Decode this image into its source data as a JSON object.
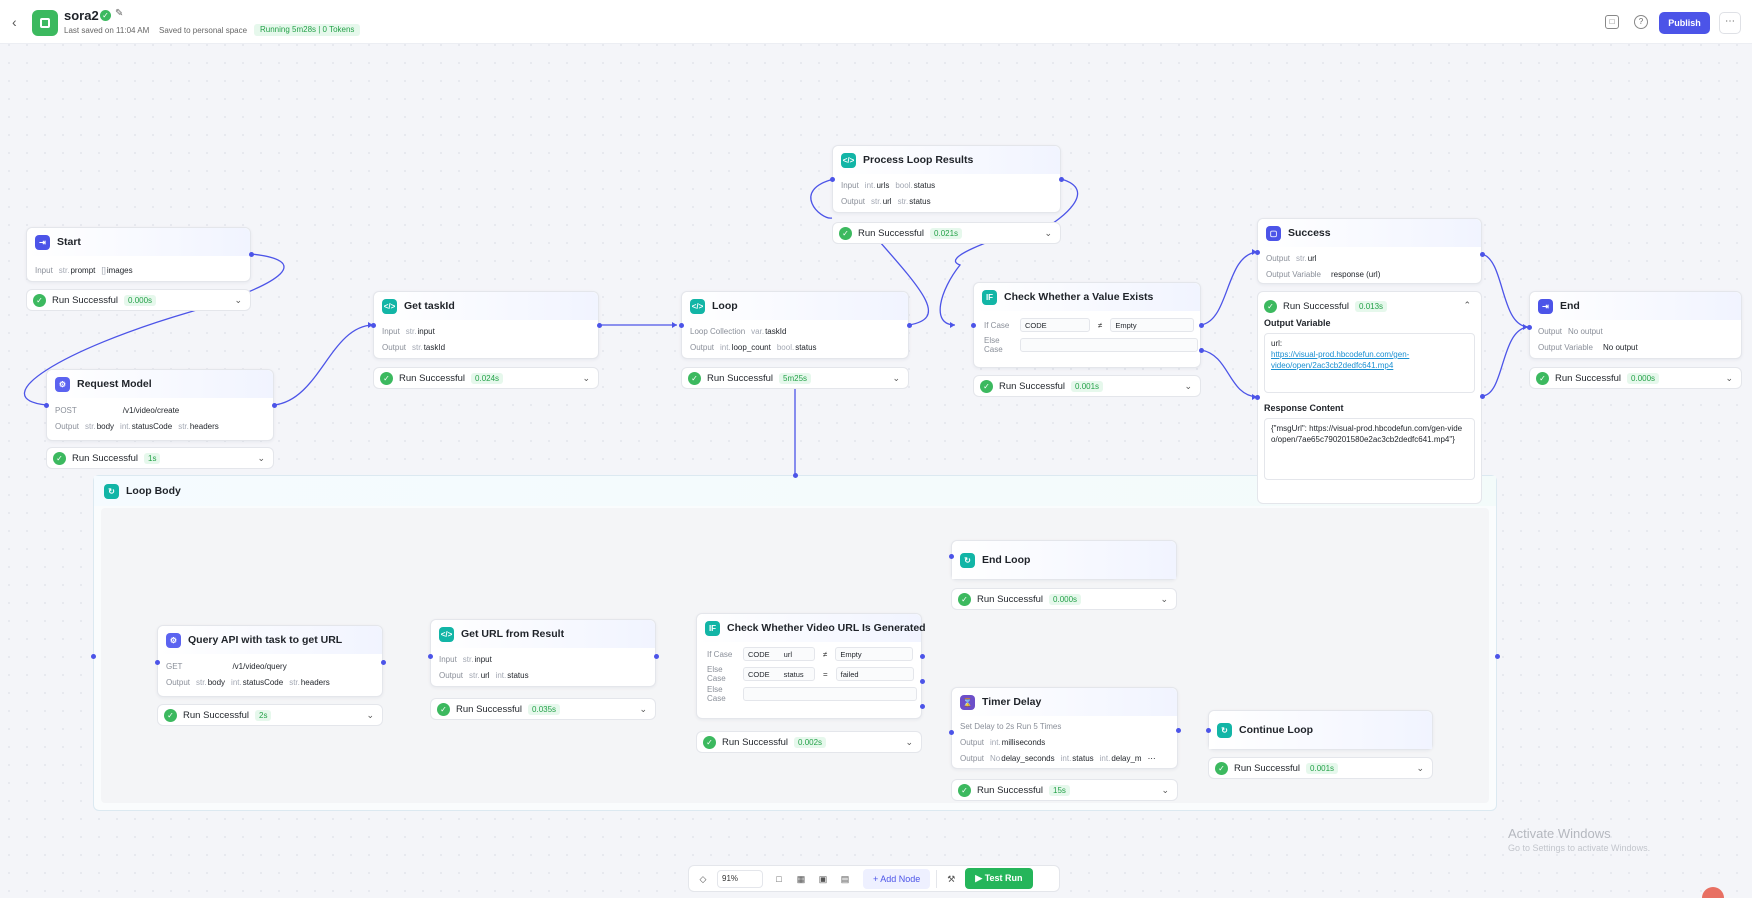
{
  "app": {
    "title": "sora2",
    "last_saved": "Last saved on 11:04 AM",
    "saved_space": "Saved to personal space",
    "running": "Running 5m28s | 0 Tokens",
    "publish": "Publish",
    "more": "⋯"
  },
  "colors": {
    "accent": "#4c54e8",
    "success": "#3cb95f",
    "success_text": "#24a148",
    "edge": "#4c54e8"
  },
  "nodes": {
    "start": {
      "title": "Start",
      "input_label": "Input",
      "in1_type": "str.",
      "in1_name": "prompt",
      "in2_type": "[]",
      "in2_name": "images",
      "status": "Run Successful",
      "time": "0.000s"
    },
    "request": {
      "title": "Request Model",
      "method": "POST",
      "url": "/v1/video/create",
      "output_label": "Output",
      "o1_type": "str.",
      "o1_name": "body",
      "o2_type": "int.",
      "o2_name": "statusCode",
      "o3_type": "str.",
      "o3_name": "headers",
      "status": "Run Successful",
      "time": "1s"
    },
    "gettask": {
      "title": "Get taskId",
      "input_label": "Input",
      "i1_type": "str.",
      "i1_name": "input",
      "output_label": "Output",
      "o1_type": "str.",
      "o1_name": "taskId",
      "status": "Run Successful",
      "time": "0.024s"
    },
    "loop": {
      "title": "Loop",
      "coll_label": "Loop Collection",
      "c_type": "var.",
      "c_name": "taskId",
      "output_label": "Output",
      "o1_type": "int.",
      "o1_name": "loop_count",
      "o2_type": "bool.",
      "o2_name": "status",
      "status": "Run Successful",
      "time": "5m25s"
    },
    "process": {
      "title": "Process Loop Results",
      "input_label": "Input",
      "i1_type": "int.",
      "i1_name": "urls",
      "i2_type": "bool.",
      "i2_name": "status",
      "output_label": "Output",
      "o1_type": "str.",
      "o1_name": "url",
      "o2_type": "str.",
      "o2_name": "status",
      "status": "Run Successful",
      "time": "0.021s"
    },
    "check": {
      "title": "Check Whether a Value Exists",
      "if_label": "If Case",
      "if_var": "CODE",
      "if_op": "≠",
      "if_val": "Empty",
      "else_label": "Else Case",
      "status": "Run Successful",
      "time": "0.001s"
    },
    "success": {
      "title": "Success",
      "output_label": "Output",
      "o1_type": "str.",
      "o1_name": "url",
      "ov_label": "Output Variable",
      "ov_value": "response (url)",
      "status": "Run Successful",
      "time": "0.013s"
    },
    "end": {
      "title": "End",
      "output_label": "Output",
      "output_value": "No output",
      "ov_label": "Output Variable",
      "ov_value": "No output",
      "status": "Run Successful",
      "time": "0.000s"
    },
    "loopbody": {
      "title": "Loop Body"
    },
    "query": {
      "title": "Query API with task to get URL",
      "method": "GET",
      "url": "/v1/video/query",
      "output_label": "Output",
      "o1_type": "str.",
      "o1_name": "body",
      "o2_type": "int.",
      "o2_name": "statusCode",
      "o3_type": "str.",
      "o3_name": "headers",
      "status": "Run Successful",
      "time": "2s"
    },
    "geturl": {
      "title": "Get URL from Result",
      "input_label": "Input",
      "i1_type": "str.",
      "i1_name": "input",
      "output_label": "Output",
      "o1_type": "str.",
      "o1_name": "url",
      "o2_type": "int.",
      "o2_name": "status",
      "status": "Run Successful",
      "time": "0.035s"
    },
    "checkvideo": {
      "title": "Check Whether Video URL Is Generated",
      "if_label": "If Case",
      "if_var": "CODE",
      "if_field": "url",
      "if_op": "≠",
      "if_val": "Empty",
      "elseif_label": "Else Case",
      "elseif_var": "CODE",
      "elseif_field": "status",
      "elseif_op": "=",
      "elseif_val": "failed",
      "else_label": "Else Case",
      "status": "Run Successful",
      "time": "0.002s"
    },
    "endloop": {
      "title": "End Loop",
      "status": "Run Successful",
      "time": "0.000s"
    },
    "timer": {
      "title": "Timer Delay",
      "desc": "Set Delay to 2s  Run 5 Times",
      "output_label": "Output",
      "o1_type": "int.",
      "o1_name": "milliseconds",
      "o2_type": "No",
      "o2_name": "delay_seconds",
      "o3_type": "int.",
      "o3_name": "status",
      "o4_type": "int.",
      "o4_name": "delay_m",
      "more": "⋯",
      "status": "Run Successful",
      "time": "15s"
    },
    "continue": {
      "title": "Continue Loop",
      "status": "Run Successful",
      "time": "0.001s"
    }
  },
  "success_panel": {
    "ov_title": "Output Variable",
    "url_label": "url:",
    "url_value": "https://visual-prod.hbcodefun.com/gen-video/open/2ac3cb2dedfc641.mp4",
    "rc_title": "Response Content",
    "rc_value": "{\"msgUrl\": https://visual-prod.hbcodefun.com/gen-video/open/7ae65c790201580e2ac3cb2dedfc641.mp4\"}"
  },
  "toolbar": {
    "zoom": "91%",
    "add_node": "+ Add Node",
    "test_run": "▶ Test Run"
  },
  "watermark": {
    "line1": "Activate Windows",
    "line2": "Go to Settings to activate Windows."
  }
}
